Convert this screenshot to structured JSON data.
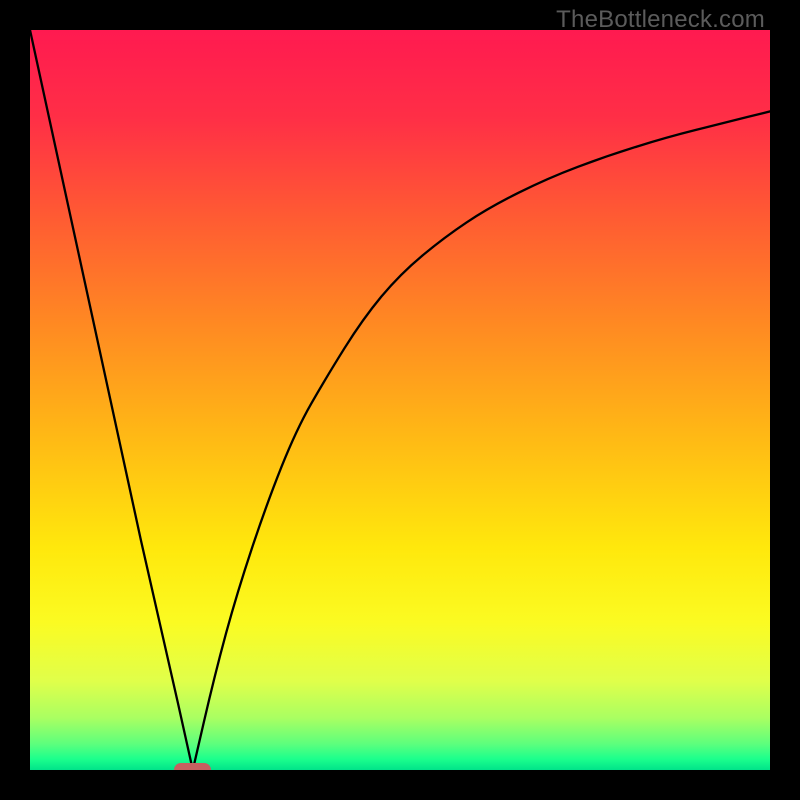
{
  "watermark": "TheBottleneck.com",
  "colors": {
    "gradient_stops": [
      {
        "offset": 0.0,
        "color": "#ff1a50"
      },
      {
        "offset": 0.12,
        "color": "#ff2f46"
      },
      {
        "offset": 0.25,
        "color": "#ff5a33"
      },
      {
        "offset": 0.4,
        "color": "#ff8a22"
      },
      {
        "offset": 0.55,
        "color": "#ffb915"
      },
      {
        "offset": 0.7,
        "color": "#ffe80c"
      },
      {
        "offset": 0.8,
        "color": "#fbfb22"
      },
      {
        "offset": 0.88,
        "color": "#e0ff4a"
      },
      {
        "offset": 0.93,
        "color": "#a9ff62"
      },
      {
        "offset": 0.965,
        "color": "#5cff7d"
      },
      {
        "offset": 0.985,
        "color": "#1cff8c"
      },
      {
        "offset": 1.0,
        "color": "#00e38a"
      }
    ],
    "curve": "#000000",
    "marker": "#c66060"
  },
  "chart_data": {
    "type": "line",
    "title": "",
    "xlabel": "",
    "ylabel": "",
    "ylim": [
      0,
      100
    ],
    "xlim": [
      0,
      100
    ],
    "minimum_x": 22,
    "series": [
      {
        "name": "left-branch",
        "x": [
          0,
          5,
          10,
          15,
          20,
          22
        ],
        "values": [
          100,
          77,
          54,
          31,
          9,
          0
        ]
      },
      {
        "name": "right-branch",
        "x": [
          22,
          25,
          28,
          32,
          36,
          40,
          45,
          50,
          56,
          62,
          70,
          78,
          86,
          94,
          100
        ],
        "values": [
          0,
          13,
          24,
          36,
          46,
          53,
          61,
          67,
          72,
          76,
          80,
          83,
          85.5,
          87.5,
          89
        ]
      }
    ],
    "marker": {
      "x": 22,
      "y": 0,
      "width_pct": 5,
      "height_pct": 2
    }
  }
}
